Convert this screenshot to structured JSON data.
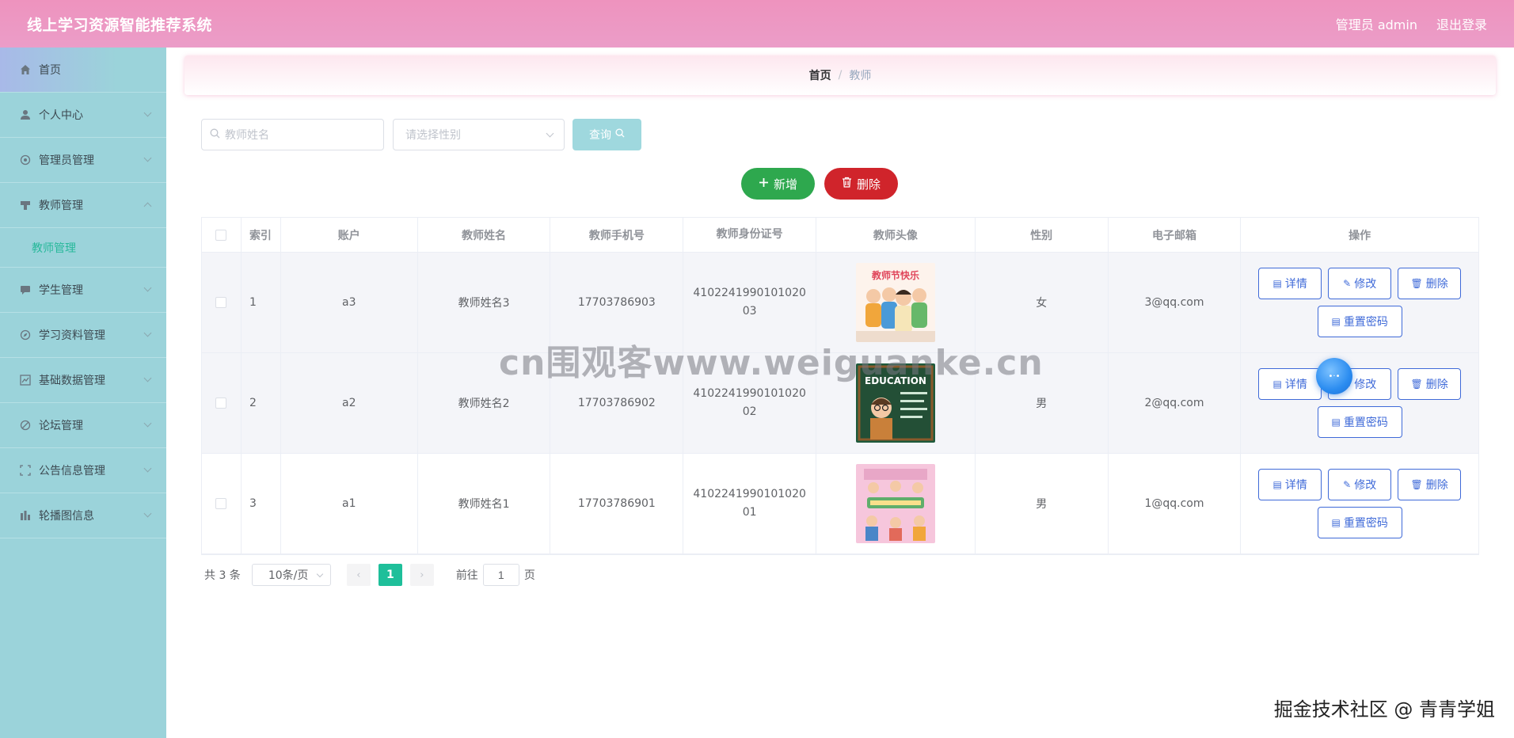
{
  "header": {
    "title": "线上学习资源智能推荐系统",
    "user": "管理员 admin",
    "logout": "退出登录"
  },
  "sidebar": {
    "items": [
      {
        "label": "首页",
        "icon": "home-icon"
      },
      {
        "label": "个人中心",
        "icon": "user-icon"
      },
      {
        "label": "管理员管理",
        "icon": "settings-icon"
      },
      {
        "label": "教师管理",
        "icon": "teacher-icon",
        "expanded": true
      },
      {
        "label": "学生管理",
        "icon": "chat-icon"
      },
      {
        "label": "学习资料管理",
        "icon": "compass-icon"
      },
      {
        "label": "基础数据管理",
        "icon": "chart-icon"
      },
      {
        "label": "论坛管理",
        "icon": "forum-icon"
      },
      {
        "label": "公告信息管理",
        "icon": "notice-icon"
      },
      {
        "label": "轮播图信息",
        "icon": "bar-icon"
      }
    ],
    "sub_active": "教师管理"
  },
  "breadcrumb": {
    "home": "首页",
    "separator": "/",
    "current": "教师"
  },
  "search": {
    "name_placeholder": "教师姓名",
    "gender_placeholder": "请选择性别",
    "query_label": "查询"
  },
  "actions": {
    "add_label": "新增",
    "delete_label": "删除"
  },
  "table": {
    "columns": [
      "索引",
      "账户",
      "教师姓名",
      "教师手机号",
      "教师身份证号",
      "教师头像",
      "性别",
      "电子邮箱",
      "操作"
    ],
    "rows": [
      {
        "index": "1",
        "account": "a3",
        "name": "教师姓名3",
        "phone": "17703786903",
        "id_card": "410224199010102003",
        "gender": "女",
        "email": "3@qq.com",
        "avatar_caption": "教师节快乐"
      },
      {
        "index": "2",
        "account": "a2",
        "name": "教师姓名2",
        "phone": "17703786902",
        "id_card": "410224199010102002",
        "gender": "男",
        "email": "2@qq.com",
        "avatar_caption": "EDUCATION"
      },
      {
        "index": "3",
        "account": "a1",
        "name": "教师姓名1",
        "phone": "17703786901",
        "id_card": "410224199010102001",
        "gender": "男",
        "email": "1@qq.com",
        "avatar_caption": ""
      }
    ],
    "op_labels": {
      "detail": "详情",
      "edit": "修改",
      "delete": "删除",
      "reset": "重置密码"
    }
  },
  "pagination": {
    "total": "共 3 条",
    "page_size": "10条/页",
    "current_page": "1",
    "goto_prefix": "前往",
    "goto_value": "1",
    "goto_suffix": "页"
  },
  "overlay": {
    "watermark": "cn围观客www.weiguanke.cn",
    "credit": "掘金技术社区 @ 青青学姐"
  },
  "colors": {
    "header": "#ee93be",
    "sidebar": "#9bd3da",
    "add": "#2ea84e",
    "delete": "#d0242b",
    "primary": "#3f6ad8",
    "active_page": "#1ebf9a"
  }
}
